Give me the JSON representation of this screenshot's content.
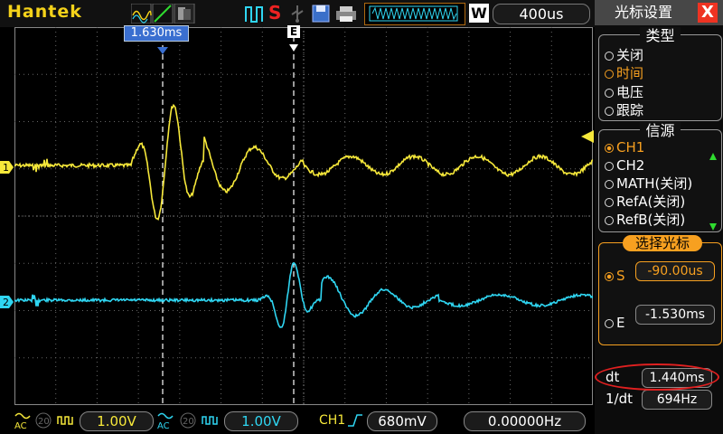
{
  "brand": "Hantek",
  "toolbar": {
    "trigger_mode": "S",
    "wave_window_label": "W",
    "timebase": "400us"
  },
  "screen": {
    "cursor1_label": "1.630ms",
    "cursor2_label": "E",
    "ch1_marker": "1",
    "ch2_marker": "2",
    "ch1_color": "#f6e83a",
    "ch2_color": "#2fd6f2"
  },
  "bottom": {
    "ch1_coupling": "AC",
    "ch1_bw": "20",
    "ch1_scale": "1.00V",
    "ch2_coupling": "AC",
    "ch2_bw": "20",
    "ch2_scale": "1.00V",
    "trig_source": "CH1",
    "trig_level": "680mV",
    "frequency": "0.00000Hz"
  },
  "panel": {
    "title": "光标设置",
    "close_label": "X",
    "type_group": {
      "title": "类型",
      "options": [
        "关闭",
        "时间",
        "电压",
        "跟踪"
      ],
      "selected": 1
    },
    "source_group": {
      "title": "信源",
      "options": [
        "CH1",
        "CH2",
        "MATH(关闭)",
        "RefA(关闭)",
        "RefB(关闭)"
      ],
      "selected": 0
    },
    "select_group": {
      "title": "选择光标",
      "s_label": "S",
      "s_value": "-90.00us",
      "e_label": "E",
      "e_value": "-1.530ms"
    },
    "dt_label": "dt",
    "dt_value": "1.440ms",
    "inv_dt_label": "1/dt",
    "inv_dt_value": "694Hz"
  },
  "colors": {
    "accent": "#f7a020",
    "highlight_oval": "#e02020"
  }
}
